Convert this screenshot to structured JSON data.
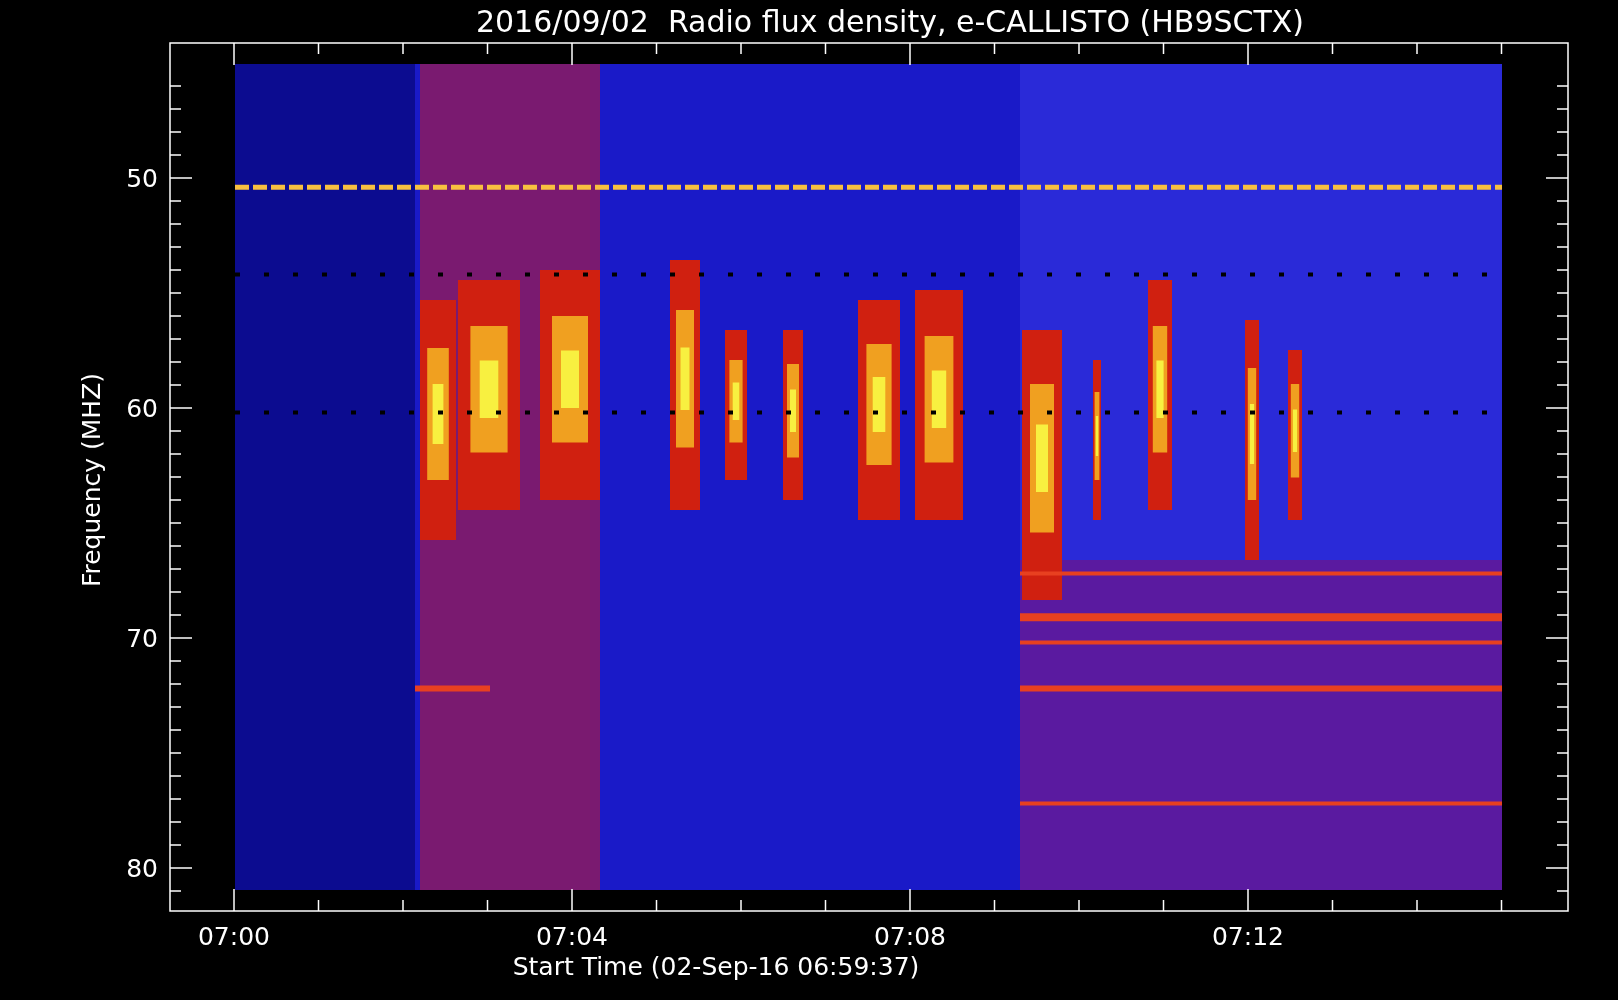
{
  "title": "2016/09/02  Radio flux density, e-CALLISTO (HB9SCTX)",
  "y_axis": {
    "title": "Frequency (MHZ)",
    "ticks": [
      "50",
      "60",
      "70",
      "80"
    ]
  },
  "x_axis": {
    "title": "Start Time (02-Sep-16 06:59:37)",
    "ticks": [
      "07:00",
      "07:04",
      "07:08",
      "07:12"
    ]
  }
}
